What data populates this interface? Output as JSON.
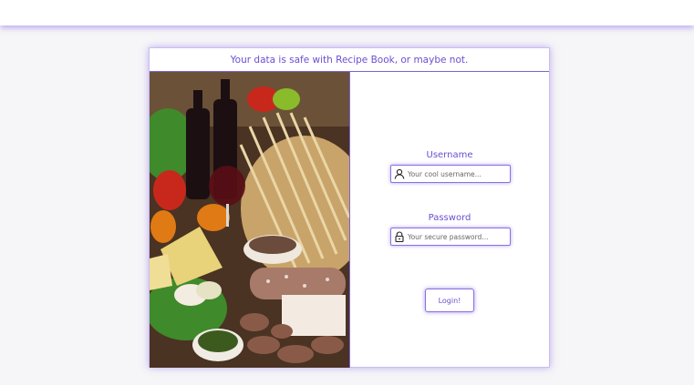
{
  "banner": {
    "text": "Your data is safe with Recipe Book, or maybe not."
  },
  "login": {
    "username_label": "Username",
    "username_placeholder": "Your cool username...",
    "username_value": "",
    "password_label": "Password",
    "password_placeholder": "Your secure password...",
    "password_value": "",
    "submit_label": "Login!"
  },
  "icons": {
    "username": "user-icon",
    "password": "lock-icon"
  },
  "colors": {
    "accent": "#6b4fd0",
    "border": "#8a72e0",
    "page_bg": "#f6f6f8"
  }
}
